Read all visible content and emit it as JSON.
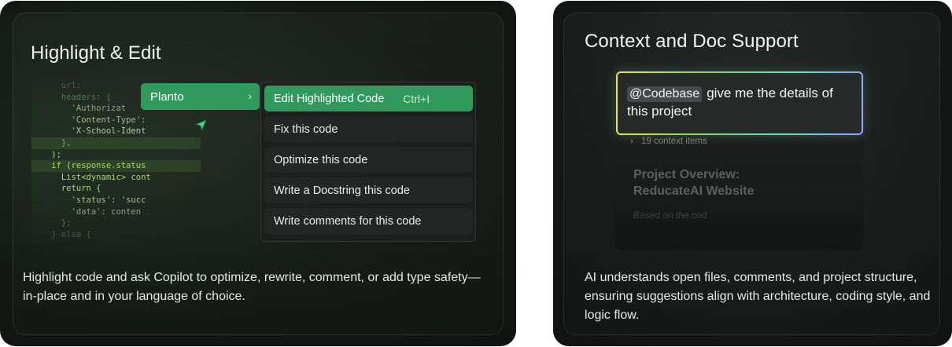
{
  "left_card": {
    "title": "Highlight & Edit",
    "description": "Highlight code and ask Copilot to optimize, rewrite, comment, or add type safety—in-place and in your language of choice.",
    "code_lines": [
      "      url:",
      "      headers: {",
      "        'Authorizat",
      "        'Content-Type':",
      "        'X-School-Ident",
      "      },",
      "    );",
      "    if (response.status",
      "      List<dynamic> cont",
      "      return {",
      "        'status': 'succ",
      "        'data': conten",
      "      };",
      "    } else {"
    ],
    "planto_menu": {
      "label": "Planto",
      "chevron": "›"
    },
    "submenu": [
      {
        "label": "Edit Highlighted Code",
        "shortcut": "Ctrl+I",
        "active": true
      },
      {
        "label": "Fix this code"
      },
      {
        "label": "Optimize this code"
      },
      {
        "label": "Write a Docstring this code"
      },
      {
        "label": "Write comments for this code"
      }
    ],
    "accent": "#2f9a5c"
  },
  "right_card": {
    "title": "Context and Doc Support",
    "description": "AI understands open files, comments, and project structure, ensuring suggestions align with architecture, coding style, and logic flow.",
    "prompt": {
      "tag": "@Codebase",
      "text": "give me the details of this project"
    },
    "context_items": "19 context items",
    "overview_title_1": "Project Overview:",
    "overview_title_2": "ReducateAI Website",
    "overview_body": "Based on the cod"
  }
}
